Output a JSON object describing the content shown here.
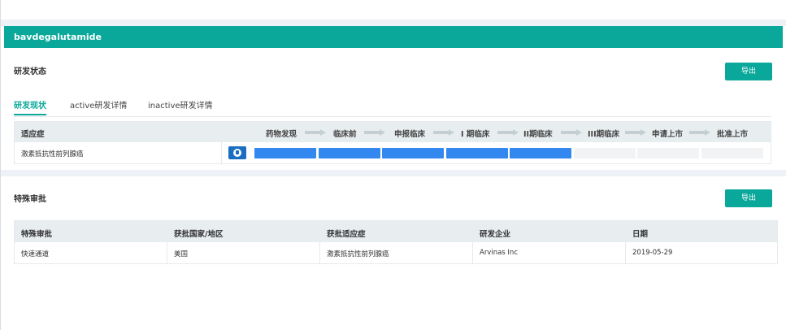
{
  "drug_name": "bavdegalutamide",
  "status_section": {
    "title": "研发状态",
    "export_label": "导出",
    "tabs": [
      {
        "label": "研发现状",
        "active": true
      },
      {
        "label": "active研发详情",
        "active": false
      },
      {
        "label": "inactive研发详情",
        "active": false
      }
    ],
    "pipeline": {
      "indication_header": "适应症",
      "stages": [
        "药物发现",
        "临床前",
        "申报临床",
        "I 期临床",
        "II期临床",
        "III期临床",
        "申请上市",
        "批准上市"
      ],
      "rows": [
        {
          "indication": "激素抵抗性前列腺癌",
          "region_icon": "globe-icon",
          "reached_stage_count": 5
        }
      ],
      "colors": {
        "filled": "#3388f0",
        "empty": "#f1f3f5"
      }
    }
  },
  "approval_section": {
    "title": "特殊审批",
    "export_label": "导出",
    "columns": [
      "特殊审批",
      "获批国家/地区",
      "获批适应症",
      "研发企业",
      "日期"
    ],
    "rows": [
      [
        "快速通道",
        "美国",
        "激素抵抗性前列腺癌",
        "Arvinas Inc",
        "2019-05-29"
      ]
    ]
  },
  "colors": {
    "accent": "#0aa89a",
    "table_header_bg": "#e8eef0"
  }
}
